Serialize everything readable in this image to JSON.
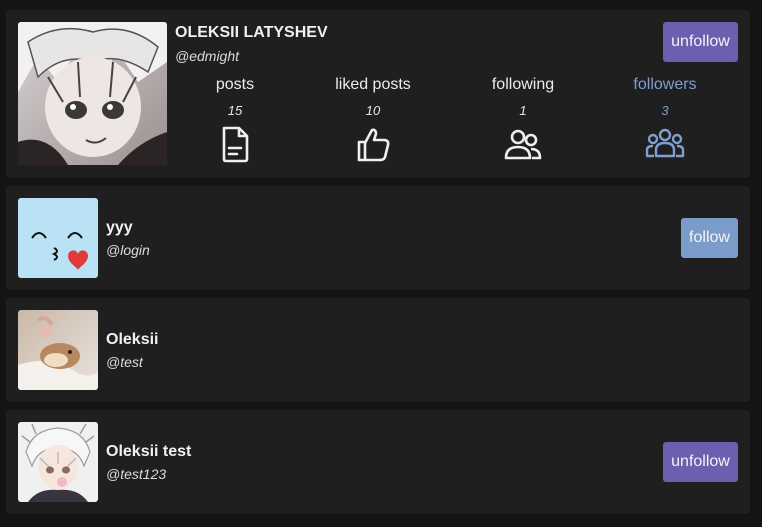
{
  "profile": {
    "name": "OLEKSII LATYSHEV",
    "handle": "@edmight",
    "action_label": "unfollow",
    "stats": [
      {
        "label": "posts",
        "count": "15",
        "icon": "document-icon"
      },
      {
        "label": "liked posts",
        "count": "10",
        "icon": "thumbs-up-icon"
      },
      {
        "label": "following",
        "count": "1",
        "icon": "users-icon"
      },
      {
        "label": "followers",
        "count": "3",
        "icon": "group-icon"
      }
    ]
  },
  "followers": [
    {
      "name": "yyy",
      "handle": "@login",
      "action_label": "follow",
      "avatar": "kiss-face-avatar"
    },
    {
      "name": "Oleksii",
      "handle": "@test",
      "avatar": "hamster-photo-avatar"
    },
    {
      "name": "Oleksii test",
      "handle": "@test123",
      "action_label": "unfollow",
      "avatar": "anime-boy-avatar"
    }
  ],
  "colors": {
    "background": "#141414",
    "card": "#1f1f1f",
    "unfollow_button": "#6c5fb0",
    "follow_button": "#7b9cc8",
    "active_tab": "#7d9fd1"
  }
}
